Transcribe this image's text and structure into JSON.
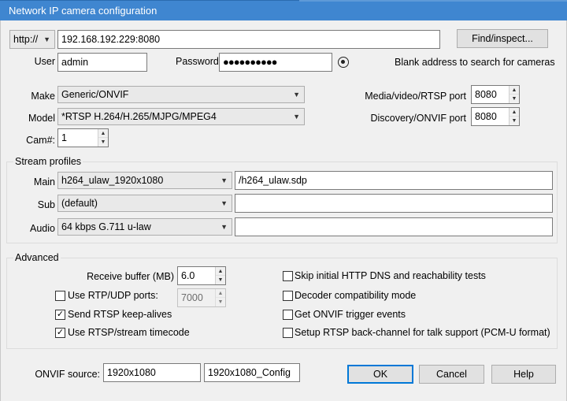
{
  "window": {
    "title": "Network IP camera configuration"
  },
  "address": {
    "protocol": "http://",
    "value": "192.168.192.229:8080",
    "find_button": "Find/inspect...",
    "hint": "Blank address to search for cameras"
  },
  "auth": {
    "user_label": "User",
    "user_value": "admin",
    "password_label": "Password",
    "password_value": "●●●●●●●●●●"
  },
  "device": {
    "make_label": "Make",
    "make_value": "Generic/ONVIF",
    "model_label": "Model",
    "model_value": "*RTSP H.264/H.265/MJPG/MPEG4",
    "cam_label": "Cam#:",
    "cam_value": "1",
    "media_port_label": "Media/video/RTSP port",
    "media_port_value": "8080",
    "discovery_port_label": "Discovery/ONVIF port",
    "discovery_port_value": "8080"
  },
  "stream_profiles": {
    "title": "Stream profiles",
    "main_label": "Main",
    "main_value": "h264_ulaw_1920x1080",
    "main_path": "/h264_ulaw.sdp",
    "sub_label": "Sub",
    "sub_value": "(default)",
    "sub_path": "",
    "audio_label": "Audio",
    "audio_value": "64 kbps G.711 u-law",
    "audio_path": ""
  },
  "advanced": {
    "title": "Advanced",
    "receive_buffer_label": "Receive buffer (MB)",
    "receive_buffer_value": "6.0",
    "rtp_udp_label": "Use RTP/UDP ports:",
    "rtp_udp_checked": false,
    "rtp_udp_value": "7000",
    "keepalive_label": "Send RTSP keep-alives",
    "keepalive_checked": true,
    "timecode_label": "Use RTSP/stream timecode",
    "timecode_checked": true,
    "skip_dns_label": "Skip initial HTTP DNS and reachability tests",
    "skip_dns_checked": false,
    "decoder_compat_label": "Decoder compatibility mode",
    "decoder_compat_checked": false,
    "onvif_events_label": "Get ONVIF trigger events",
    "onvif_events_checked": false,
    "backchannel_label": "Setup RTSP back-channel for talk support (PCM-U format)",
    "backchannel_checked": false
  },
  "onvif_source": {
    "label": "ONVIF source:",
    "value": "1920x1080",
    "config": "1920x1080_Config"
  },
  "buttons": {
    "ok": "OK",
    "cancel": "Cancel",
    "help": "Help"
  },
  "glyphs": {
    "combo_arrow": "▼",
    "check_mark": "✓",
    "spin_up": "▲",
    "spin_down": "▼"
  }
}
